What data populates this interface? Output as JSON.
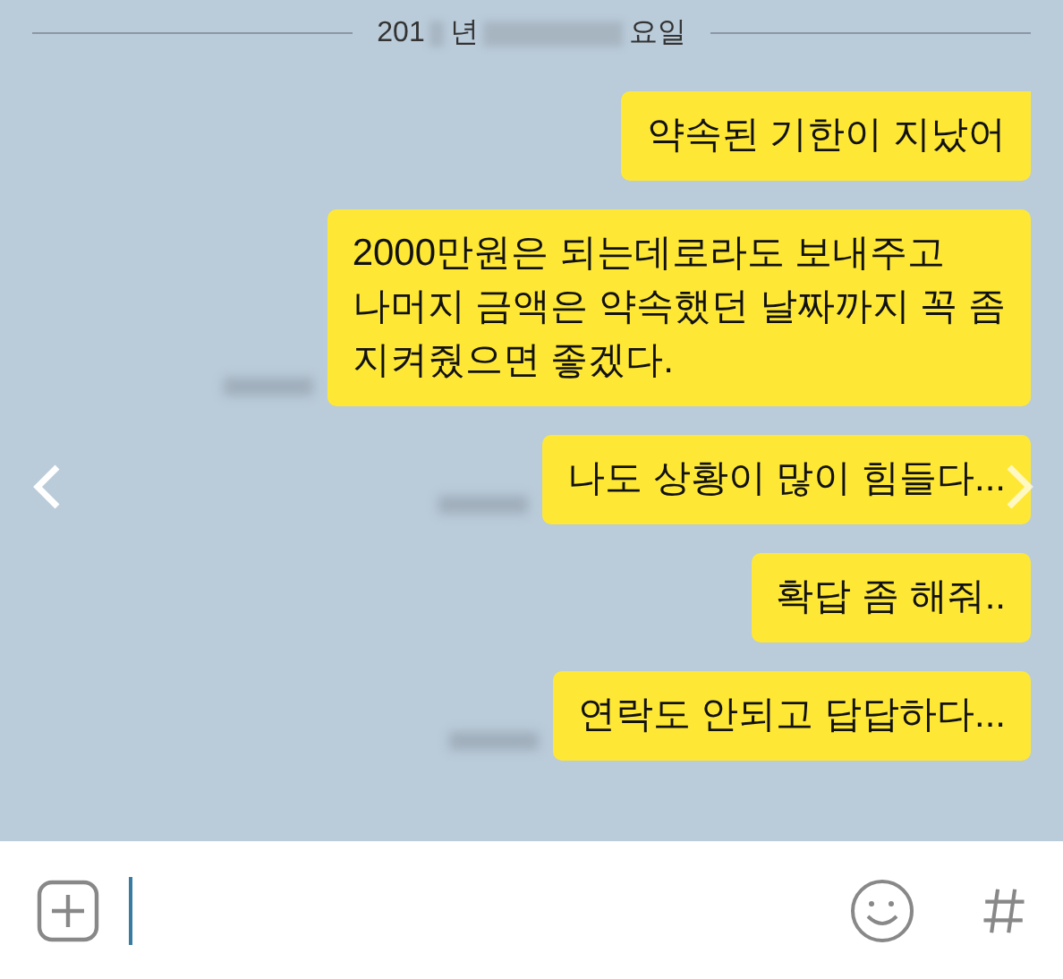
{
  "date_header": {
    "parts": [
      "201",
      "년",
      "요일"
    ]
  },
  "messages": [
    {
      "text": "약속된 기한이 지났어",
      "tail": true,
      "blurred_time": false
    },
    {
      "text": "2000만원은 되는데로라도 보내주고\n나머지 금액은 약속했던 날짜까지 꼭 좀\n지켜줬으면 좋겠다.",
      "tail": false,
      "blurred_time": true
    },
    {
      "text": "나도 상황이 많이 힘들다...",
      "tail": false,
      "blurred_time": true
    },
    {
      "text": "확답 좀 해줘..",
      "tail": false,
      "blurred_time": false
    },
    {
      "text": "연락도 안되고 답답하다...",
      "tail": false,
      "blurred_time": true
    }
  ]
}
